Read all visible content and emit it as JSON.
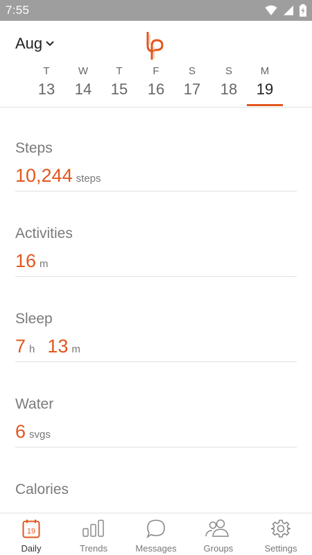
{
  "status_bar": {
    "time": "7:55"
  },
  "header": {
    "month": "Aug",
    "week": [
      {
        "letter": "T",
        "num": "13"
      },
      {
        "letter": "W",
        "num": "14"
      },
      {
        "letter": "T",
        "num": "15"
      },
      {
        "letter": "F",
        "num": "16"
      },
      {
        "letter": "S",
        "num": "17"
      },
      {
        "letter": "S",
        "num": "18"
      },
      {
        "letter": "M",
        "num": "19"
      }
    ],
    "selected_day": "19"
  },
  "metrics": {
    "steps": {
      "title": "Steps",
      "value": "10,244",
      "unit": "steps"
    },
    "activities": {
      "title": "Activities",
      "value": "16",
      "unit": "m"
    },
    "sleep": {
      "title": "Sleep",
      "hours": "7",
      "hours_unit": "h",
      "minutes": "13",
      "minutes_unit": "m"
    },
    "water": {
      "title": "Water",
      "value": "6",
      "unit": "svgs"
    },
    "calories": {
      "title": "Calories"
    }
  },
  "bottom_nav": {
    "daily": {
      "label": "Daily",
      "badge": "19"
    },
    "trends": {
      "label": "Trends"
    },
    "messages": {
      "label": "Messages"
    },
    "groups": {
      "label": "Groups"
    },
    "settings": {
      "label": "Settings"
    }
  },
  "colors": {
    "accent": "#e2561d",
    "status_bar": "#9e9e9e",
    "divider": "#e0e0e0"
  }
}
